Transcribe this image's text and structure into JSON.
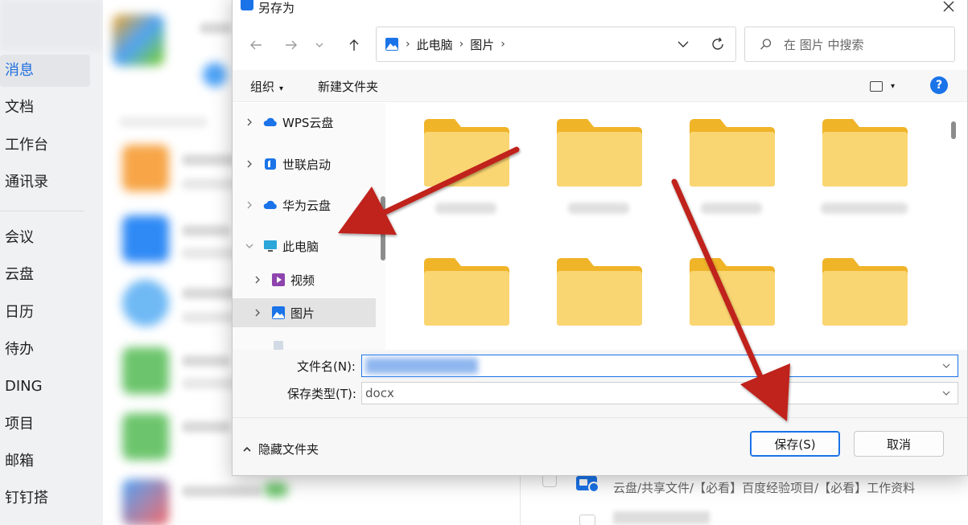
{
  "background_app": {
    "sidebar": [
      {
        "label": "消息",
        "active": true
      },
      {
        "label": "文档"
      },
      {
        "label": "工作台"
      },
      {
        "label": "通讯录"
      },
      {
        "label": "会议"
      },
      {
        "label": "云盘"
      },
      {
        "label": "日历"
      },
      {
        "label": "待办"
      },
      {
        "label": "DING"
      },
      {
        "label": "项目"
      },
      {
        "label": "邮箱"
      },
      {
        "label": "钉钉搭"
      }
    ],
    "file_path": "云盘/共享文件/【必看】百度经验项目/【必看】工作资料"
  },
  "dialog": {
    "title": "另存为",
    "address": {
      "crumbs": [
        "此电脑",
        "图片"
      ],
      "icon": "pictures-icon"
    },
    "search": {
      "placeholder": "在 图片 中搜索"
    },
    "toolbar": {
      "organize": "组织",
      "new_folder": "新建文件夹",
      "help": "?"
    },
    "tree": [
      {
        "label": "WPS云盘",
        "icon": "cloud-icon",
        "color": "#1a73e8"
      },
      {
        "label": "世联启动",
        "icon": "app-icon",
        "color": "#1a73e8"
      },
      {
        "label": "华为云盘",
        "icon": "cloud-icon",
        "color": "#1a73e8"
      },
      {
        "label": "此电脑",
        "icon": "computer-icon",
        "expanded": true
      },
      {
        "label": "视频",
        "icon": "video-icon",
        "color": "#8e44ad"
      },
      {
        "label": "图片",
        "icon": "pictures-icon",
        "selected": true
      }
    ],
    "filename_label": "文件名(N):",
    "filetype_label": "保存类型(T):",
    "filetype_value": "docx",
    "hide_folders": "隐藏文件夹",
    "save_button": "保存(S)",
    "cancel_button": "取消"
  },
  "colors": {
    "accent": "#1a73e8",
    "folder": "#f8d46a",
    "arrow": "#c0201a"
  }
}
